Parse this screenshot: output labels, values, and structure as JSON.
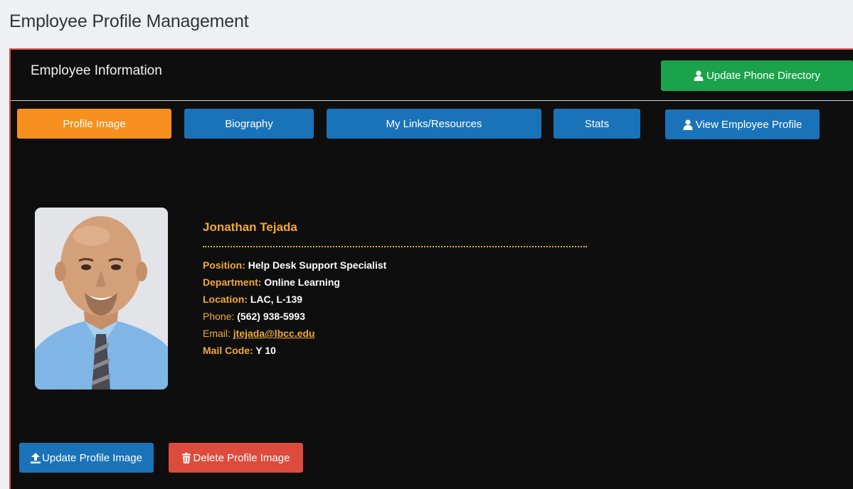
{
  "page": {
    "title": "Employee Profile Management"
  },
  "panel": {
    "title": "Employee Information",
    "update_directory_label": "Update Phone Directory"
  },
  "tabs": [
    {
      "label": "Profile Image",
      "active": true
    },
    {
      "label": "Biography",
      "active": false
    },
    {
      "label": "My Links/Resources",
      "active": false
    },
    {
      "label": "Stats",
      "active": false
    }
  ],
  "view_profile_label": "View Employee Profile",
  "employee": {
    "name": "Jonathan Tejada",
    "position_label": "Position:",
    "position": "Help Desk Support Specialist",
    "department_label": "Department:",
    "department": "Online Learning",
    "location_label": "Location:",
    "location": "LAC, L-139",
    "phone_label": "Phone:",
    "phone": "(562) 938-5993",
    "email_label": "Email:",
    "email": "jtejada@lbcc.edu",
    "mailcode_label": "Mail Code:",
    "mailcode": "Y 10"
  },
  "actions": {
    "update_image_label": "Update Profile Image",
    "delete_image_label": "Delete Profile Image"
  },
  "icons": {
    "user": "user-icon",
    "upload": "upload-icon",
    "trash": "trash-icon"
  },
  "colors": {
    "green": "#1aa34a",
    "blue": "#1a73b8",
    "orange": "#f7901e",
    "red": "#dc4b3c",
    "gold": "#f0a83a",
    "panel_bg": "#0e0e0e",
    "panel_border": "#d9534f"
  }
}
